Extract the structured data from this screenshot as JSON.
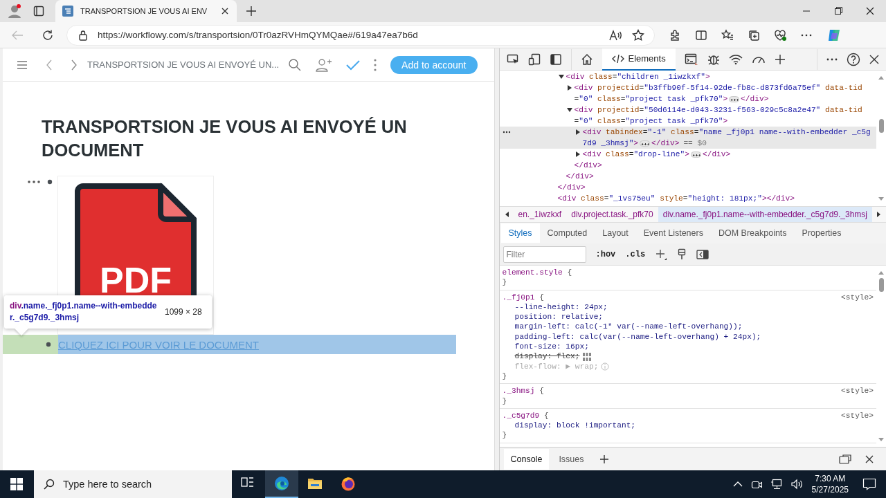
{
  "browser": {
    "tab": {
      "title": "TRANSPORTSION JE VOUS AI ENV",
      "selected": true
    },
    "url": "https://workflowy.com/s/transportsion/0Tr0azRVHmQYMQae#/619a47ea7b6d"
  },
  "page": {
    "breadcrumb": "TRANSPORTSION JE VOUS AI ENVOYÉ UN...",
    "action_button": "Add to account",
    "title": "TRANSPORTSION JE VOUS AI ENVOYÉ UN DOCUMENT",
    "embed_label": "PDF",
    "link": "CLIQUEZ ICI POUR VOIR LE DOCUMENT",
    "link_highlighted": true,
    "tooltip": {
      "tag": "div",
      "selector": ".name._fj0p1.name--with-embedder._c5g7d9._3hmsj",
      "size": "1099 × 28"
    }
  },
  "devtools": {
    "tabs": [
      {
        "label": "Elements",
        "selected": true
      }
    ],
    "dom_tree": [
      {
        "open": "<div class=\"children _1iwzkxf\">",
        "expanded": true,
        "has_content": true,
        "selected": false,
        "close": "</div>",
        "children": [
          {
            "open": "<div projectid=\"b3ffb90f-5f14-92de-fb8c-d873fd6a75ef\" data-tid=\"0\" class=\"project task _pfk70\">",
            "expanded": false,
            "has_content": true,
            "selected": false,
            "close": "</div>"
          },
          {
            "open": "<div projectid=\"50d6114e-d043-3231-f563-029c5c8a2e47\" data-tid=\"0\" class=\"project task _pfk70\">",
            "expanded": true,
            "has_content": true,
            "selected": false,
            "close": "</div>",
            "children": [
              {
                "open": "<div tabindex=\"-1\" class=\"name    _fj0p1  name--with-embedder  _c5g7d9  _3hmsj\">",
                "expanded": false,
                "has_content": true,
                "selected": true,
                "close": "</div>",
                "suffix": "== $0"
              },
              {
                "open": "<div class=\"drop-line\">",
                "expanded": false,
                "has_content": true,
                "selected": false,
                "close": "</div>"
              }
            ]
          }
        ]
      }
    ],
    "dom_parent_close": "</div>",
    "dom_next_line": "<div class=\"_1vs75eu\" style=\"height: 181px;\"></div>",
    "breadcrumbs": [
      {
        "label": "en._1iwzkxf",
        "selected": false
      },
      {
        "label": "div.project.task._pfk70",
        "selected": false
      },
      {
        "label": "div.name._fj0p1.name--with-embedder._c5g7d9._3hmsj",
        "selected": true
      }
    ],
    "panel_tabs": [
      {
        "label": "Styles",
        "selected": true
      },
      {
        "label": "Computed",
        "selected": false
      },
      {
        "label": "Layout",
        "selected": false
      },
      {
        "label": "Event Listeners",
        "selected": false
      },
      {
        "label": "DOM Breakpoints",
        "selected": false
      },
      {
        "label": "Properties",
        "selected": false
      }
    ],
    "filter_placeholder": "Filter",
    "style_buttons": [
      ":hov",
      ".cls"
    ],
    "rules": [
      {
        "selector": "element.style",
        "brace": "{",
        "close": "}"
      },
      {
        "selector": "._fj0p1",
        "brace": "{",
        "source": "<style>",
        "close": "}",
        "declarations": [
          {
            "kind": "plain",
            "text": "--line-height: 24px;",
            "overridden": false,
            "inactive": false
          },
          {
            "kind": "plain",
            "text": "position: relative;",
            "overridden": false,
            "inactive": false
          },
          {
            "kind": "plain",
            "text": "margin-left: calc(-1* var(--name-left-overhang));",
            "overridden": false,
            "inactive": false
          },
          {
            "kind": "plain",
            "text": "padding-left: calc(var(--name-left-overhang) + 24px);",
            "overridden": false,
            "inactive": false
          },
          {
            "kind": "plain",
            "text": "font-size: 16px;",
            "overridden": false,
            "inactive": false
          },
          {
            "kind": "flexbox",
            "text": "display: flex;",
            "overridden": true,
            "inactive": false
          },
          {
            "kind": "hinted",
            "text": "flex-flow: ▶ wrap;",
            "overridden": false,
            "inactive": true
          }
        ]
      },
      {
        "selector": "._3hmsj",
        "brace": "{",
        "source": "<style>",
        "close": "}"
      },
      {
        "selector": "._c5g7d9",
        "brace": "{",
        "source": "<style>",
        "close": "}",
        "declarations": [
          {
            "kind": "plain",
            "text": "display: block !important;",
            "overridden": false,
            "inactive": false
          }
        ]
      }
    ],
    "drawer_tabs": [
      {
        "label": "Console",
        "selected": true
      },
      {
        "label": "Issues",
        "selected": false
      }
    ]
  },
  "taskbar": {
    "search_placeholder": "Type here to search",
    "apps": [
      {
        "kind": "taskview",
        "active": false
      },
      {
        "kind": "edge",
        "active": true
      },
      {
        "kind": "folder",
        "active": false
      },
      {
        "kind": "firefox",
        "active": false
      }
    ],
    "time": "7:30 AM",
    "date": "5/27/2025"
  }
}
